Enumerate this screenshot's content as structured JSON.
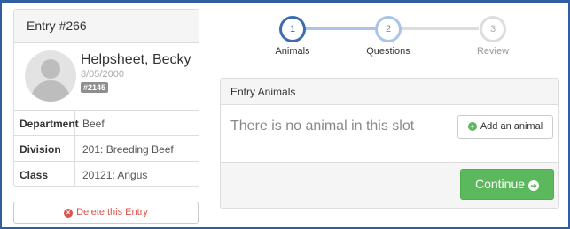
{
  "entry": {
    "title": "Entry #266",
    "name": "Helpsheet, Becky",
    "dob": "8/05/2000",
    "tag": "#2145",
    "details": [
      {
        "key": "Department",
        "value": "Beef"
      },
      {
        "key": "Division",
        "value": "201: Breeding Beef"
      },
      {
        "key": "Class",
        "value": "20121: Angus"
      }
    ],
    "delete_label": "Delete this Entry"
  },
  "steps": [
    {
      "number": "1",
      "label": "Animals",
      "state": "active"
    },
    {
      "number": "2",
      "label": "Questions",
      "state": "next"
    },
    {
      "number": "3",
      "label": "Review",
      "state": "upcoming"
    }
  ],
  "animals_panel": {
    "title": "Entry Animals",
    "empty_message": "There is no animal in this slot",
    "add_label": "Add an animal",
    "continue_label": "Continue"
  },
  "colors": {
    "frame": "#2f5fa0",
    "step_active": "#3c6cb4",
    "step_next": "#a9c4e8",
    "step_upcoming": "#dddddd",
    "success": "#5cb85c",
    "danger": "#d9534f"
  },
  "icons": {
    "delete": "times-circle-icon",
    "add": "plus-circle-icon",
    "continue": "arrow-circle-right-icon",
    "avatar": "user-placeholder-icon"
  }
}
